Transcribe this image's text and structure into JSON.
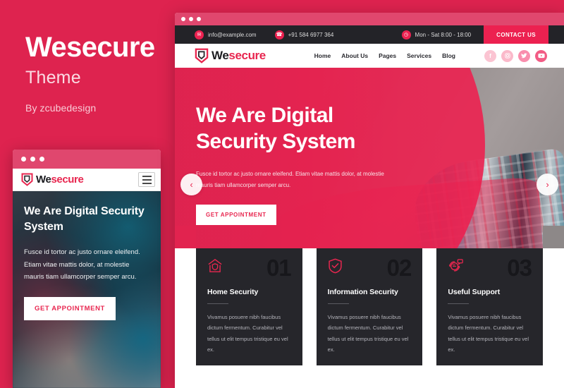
{
  "promo": {
    "title": "Wesecure",
    "subtitle": "Theme",
    "author": "By zcubedesign"
  },
  "colors": {
    "background": "#DE234F",
    "accent": "#EC2150",
    "dark": "#26262B",
    "topbar": "#232328"
  },
  "brand": {
    "name_first": "We",
    "name_second": "secure",
    "logo_icon": "shield-logo-icon"
  },
  "browser_chrome": {
    "dots": [
      "dot-1",
      "dot-2",
      "dot-3"
    ]
  },
  "topbar": {
    "email": "info@example.com",
    "email_icon": "envelope-icon",
    "phone": "+91 584 6977 364",
    "phone_icon": "phone-icon",
    "hours": "Mon - Sat 8:00 - 18:00",
    "hours_icon": "clock-icon",
    "contact_button": "CONTACT US"
  },
  "nav": {
    "links": [
      {
        "label": "Home"
      },
      {
        "label": "About Us"
      },
      {
        "label": "Pages"
      },
      {
        "label": "Services"
      },
      {
        "label": "Blog"
      }
    ],
    "social": [
      {
        "name": "facebook-icon",
        "glyph": "f",
        "color": "#fbc4d2"
      },
      {
        "name": "instagram-icon",
        "glyph": "▣",
        "color": "#fbb9ca"
      },
      {
        "name": "twitter-icon",
        "glyph": "✦",
        "color": "#f98ead"
      },
      {
        "name": "youtube-icon",
        "glyph": "▶",
        "color": "#f25c85"
      }
    ]
  },
  "hero": {
    "title_line1": "We Are Digital",
    "title_line2": "Security System",
    "paragraph": "Fusce id tortor ac justo ornare eleifend. Etiam vitae mattis dolor, at molestie mauris tiam ullamcorper semper arcu.",
    "button": "GET APPOINTMENT",
    "prev_arrow": "‹",
    "next_arrow": "›"
  },
  "mobile": {
    "menu_icon": "hamburger-menu-icon",
    "title": "We Are Digital Security System",
    "paragraph": "Fusce id tortor ac justo ornare eleifend. Etiam vitae mattis dolor, at molestie mauris tiam ullamcorper semper arcu.",
    "button": "GET APPOINTMENT"
  },
  "cards": [
    {
      "number": "01",
      "title": "Home Security",
      "text": "Vivamus posuere nibh faucibus dictum fermentum. Curabitur vel tellus ut elit tempus tristique eu vel ex.",
      "icon": "home-shield-icon"
    },
    {
      "number": "02",
      "title": "Information Security",
      "text": "Vivamus posuere nibh faucibus dictum fermentum. Curabitur vel tellus ut elit tempus tristique eu vel ex.",
      "icon": "shield-check-icon"
    },
    {
      "number": "03",
      "title": "Useful Support",
      "text": "Vivamus posuere nibh faucibus dictum fermentum. Curabitur vel tellus ut elit tempus tristique eu vel ex.",
      "icon": "support-headset-icon"
    }
  ]
}
